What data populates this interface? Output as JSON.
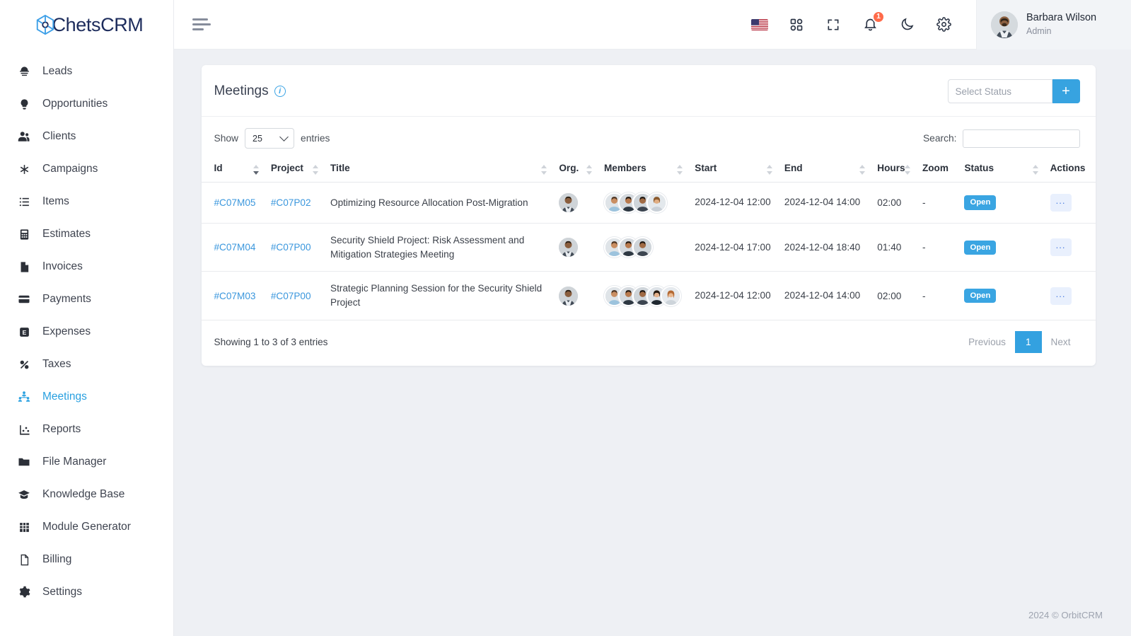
{
  "brand": {
    "name": "ChetsCRM",
    "logo_icon": "chets-logo-icon"
  },
  "sidebar": {
    "items": [
      {
        "label": "Leads",
        "icon": "megaphone-icon",
        "active": false
      },
      {
        "label": "Opportunities",
        "icon": "lightbulb-icon",
        "active": false
      },
      {
        "label": "Clients",
        "icon": "users-icon",
        "active": false
      },
      {
        "label": "Campaigns",
        "icon": "asterisk-icon",
        "active": false
      },
      {
        "label": "Items",
        "icon": "list-icon",
        "active": false
      },
      {
        "label": "Estimates",
        "icon": "calculator-icon",
        "active": false
      },
      {
        "label": "Invoices",
        "icon": "file-icon",
        "active": false
      },
      {
        "label": "Payments",
        "icon": "credit-card-icon",
        "active": false
      },
      {
        "label": "Expenses",
        "icon": "expense-icon",
        "active": false
      },
      {
        "label": "Taxes",
        "icon": "percent-icon",
        "active": false
      },
      {
        "label": "Meetings",
        "icon": "people-group-icon",
        "active": true
      },
      {
        "label": "Reports",
        "icon": "chart-icon",
        "active": false
      },
      {
        "label": "File Manager",
        "icon": "folder-icon",
        "active": false
      },
      {
        "label": "Knowledge Base",
        "icon": "graduation-cap-icon",
        "active": false
      },
      {
        "label": "Module Generator",
        "icon": "grid-table-icon",
        "active": false
      },
      {
        "label": "Billing",
        "icon": "document-icon",
        "active": false
      },
      {
        "label": "Settings",
        "icon": "gear-icon",
        "active": false
      }
    ]
  },
  "topbar": {
    "menu_toggle_icon": "hamburger-icon",
    "icons": [
      {
        "name": "flag-usa-icon",
        "label": "US"
      },
      {
        "name": "apps-grid-icon",
        "label": ""
      },
      {
        "name": "fullscreen-icon",
        "label": ""
      },
      {
        "name": "bell-icon",
        "label": ""
      },
      {
        "name": "moon-icon",
        "label": ""
      },
      {
        "name": "gear-icon",
        "label": ""
      }
    ],
    "notification_count": "1",
    "user": {
      "name": "Barbara Wilson",
      "role": "Admin",
      "avatar": "user-avatar"
    }
  },
  "card": {
    "title": "Meetings",
    "info_icon": "info-icon",
    "status_filter_placeholder": "Select Status",
    "add_button_label": "+",
    "show_label": "Show",
    "entries_label": "entries",
    "page_length": "25",
    "search_label": "Search:",
    "search_value": "",
    "search_placeholder": ""
  },
  "table": {
    "columns": [
      {
        "label": "Id",
        "sortable": true,
        "sorted": "desc"
      },
      {
        "label": "Project",
        "sortable": true,
        "sorted": "none"
      },
      {
        "label": "Title",
        "sortable": true,
        "sorted": "none"
      },
      {
        "label": "Org.",
        "sortable": true,
        "sorted": "none"
      },
      {
        "label": "Members",
        "sortable": true,
        "sorted": "none"
      },
      {
        "label": "Start",
        "sortable": true,
        "sorted": "none"
      },
      {
        "label": "End",
        "sortable": true,
        "sorted": "none"
      },
      {
        "label": "Hours",
        "sortable": true,
        "sorted": "none"
      },
      {
        "label": "Zoom",
        "sortable": false,
        "sorted": "none"
      },
      {
        "label": "Status",
        "sortable": true,
        "sorted": "none"
      },
      {
        "label": "Actions",
        "sortable": false,
        "sorted": "none"
      }
    ],
    "rows": [
      {
        "id": "#C07M05",
        "project": "#C07P02",
        "title": "Optimizing Resource Allocation Post-Migration",
        "org_avatar": "org-avatar",
        "member_count": 4,
        "start": "2024-12-04 12:00",
        "end": "2024-12-04 14:00",
        "hours": "02:00",
        "zoom": "-",
        "status": "Open",
        "action_label": "..."
      },
      {
        "id": "#C07M04",
        "project": "#C07P00",
        "title": "Security Shield Project: Risk Assessment and Mitigation Strategies Meeting",
        "org_avatar": "org-avatar",
        "member_count": 3,
        "start": "2024-12-04 17:00",
        "end": "2024-12-04 18:40",
        "hours": "01:40",
        "zoom": "-",
        "status": "Open",
        "action_label": "..."
      },
      {
        "id": "#C07M03",
        "project": "#C07P00",
        "title": "Strategic Planning Session for the Security Shield Project",
        "org_avatar": "org-avatar",
        "member_count": 5,
        "start": "2024-12-04 12:00",
        "end": "2024-12-04 14:00",
        "hours": "02:00",
        "zoom": "-",
        "status": "Open",
        "action_label": "..."
      }
    ]
  },
  "footer": {
    "entries_info": "Showing 1 to 3 of 3 entries",
    "pagination": {
      "previous": "Previous",
      "current": "1",
      "next": "Next"
    },
    "copyright": "2024 © OrbitCRM"
  },
  "colors": {
    "accent": "#37a3e0",
    "link": "#3b97dd",
    "badge_open": "#3aa5e2",
    "notification": "#ff6b4a",
    "sidebar_active": "#29a0e0"
  }
}
